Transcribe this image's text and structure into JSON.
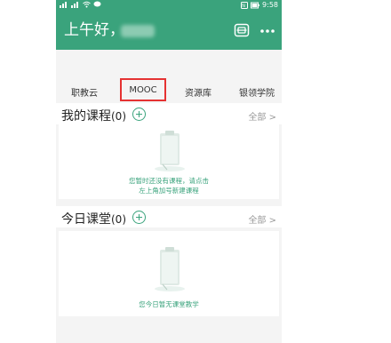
{
  "status": {
    "time": "9:58"
  },
  "header": {
    "greeting": "上午好，"
  },
  "tabs": [
    "职教云",
    "MOOC",
    "资源库",
    "银领学院"
  ],
  "courses": {
    "title": "我的课程",
    "count": "(0)",
    "all": "全部 >",
    "empty_line1": "您暂时还没有课程，请点击",
    "empty_line2": "左上角加号新建课程"
  },
  "today": {
    "title": "今日课堂",
    "count": "(0)",
    "all": "全部 >",
    "empty": "您今日暂无课堂教学"
  },
  "colors": {
    "primary": "#3aa37c",
    "highlight": "#e53232"
  }
}
